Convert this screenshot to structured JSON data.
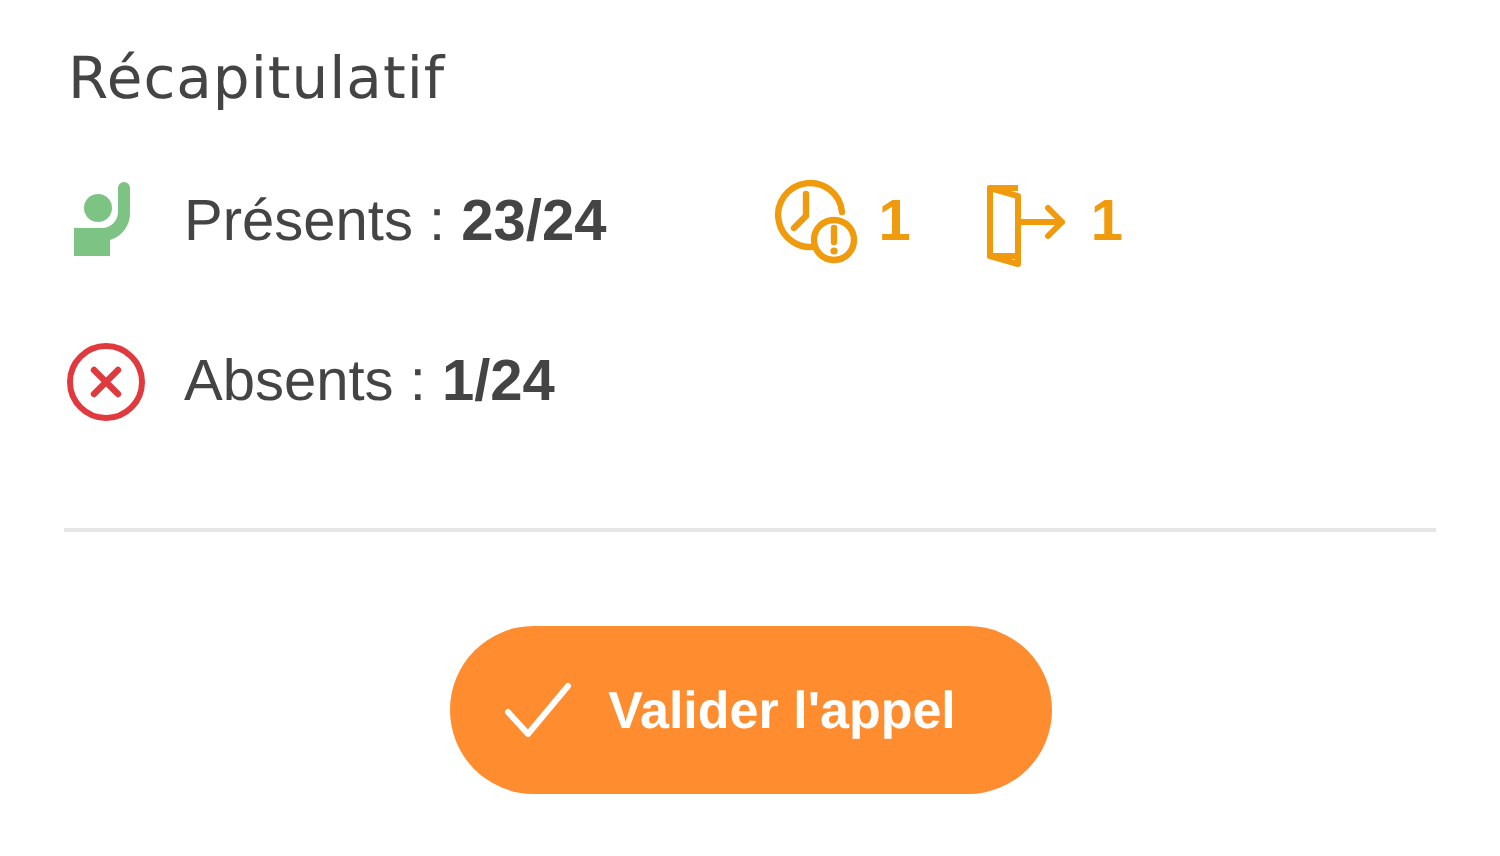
{
  "title": "Récapitulatif",
  "rows": [
    {
      "kind": "present",
      "text": "Présents : **23/24**",
      "indicators": [
        {
          "kind": "late",
          "count": "1"
        },
        {
          "kind": "left",
          "count": "1"
        }
      ]
    },
    {
      "kind": "absent",
      "text": "Absents : **1/24**",
      "indicators": []
    }
  ],
  "button": {
    "label": "Valider l'appel"
  }
}
